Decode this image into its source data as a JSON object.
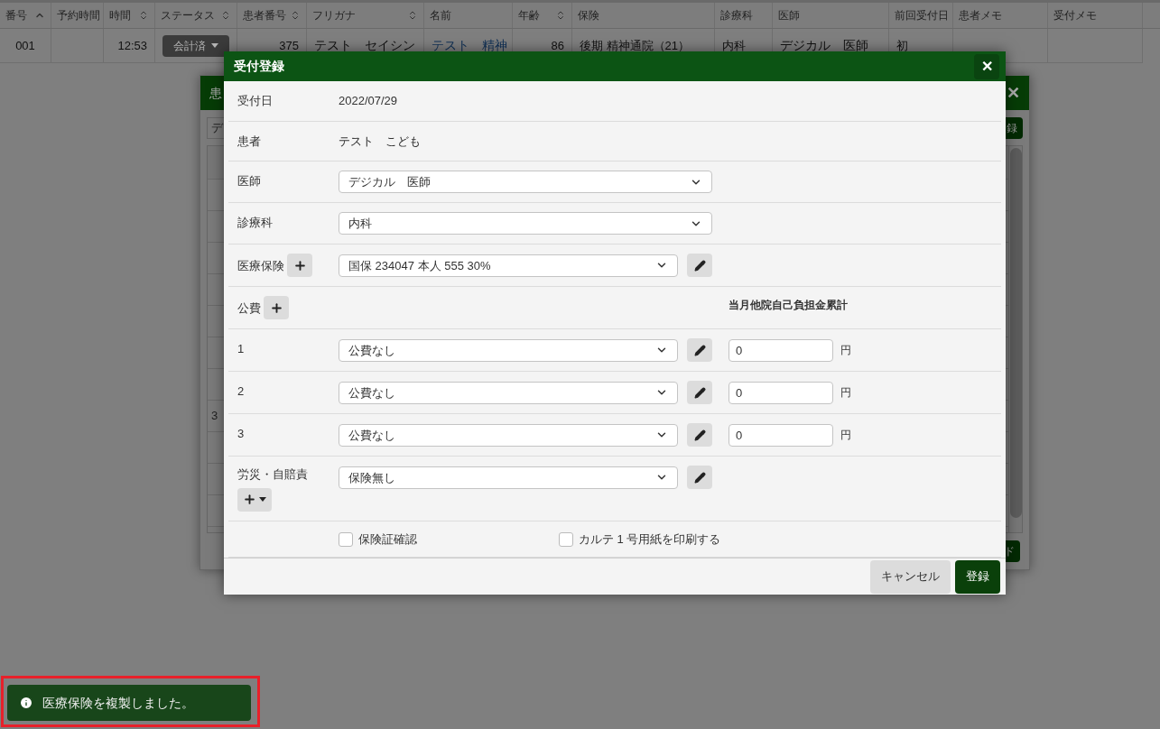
{
  "table": {
    "columns": [
      {
        "label": "番号",
        "sortable": true,
        "sorted": true
      },
      {
        "label": "予約時間",
        "sortable": false,
        "sorted": false
      },
      {
        "label": "時間",
        "sortable": true,
        "sorted": false
      },
      {
        "label": "ステータス",
        "sortable": true,
        "sorted": false
      },
      {
        "label": "患者番号",
        "sortable": true,
        "sorted": false
      },
      {
        "label": "フリガナ",
        "sortable": true,
        "sorted": false
      },
      {
        "label": "名前",
        "sortable": false,
        "sorted": false
      },
      {
        "label": "年齢",
        "sortable": true,
        "sorted": false
      },
      {
        "label": "保険",
        "sortable": false,
        "sorted": false
      },
      {
        "label": "診療科",
        "sortable": false,
        "sorted": false
      },
      {
        "label": "医師",
        "sortable": false,
        "sorted": false
      },
      {
        "label": "前回受付日",
        "sortable": false,
        "sorted": false
      },
      {
        "label": "患者メモ",
        "sortable": false,
        "sorted": false
      },
      {
        "label": "受付メモ",
        "sortable": false,
        "sorted": false
      }
    ],
    "rows": [
      {
        "cells": [
          {
            "kind": "center",
            "text": "001"
          },
          {
            "kind": "blank"
          },
          {
            "kind": "right",
            "text": "12:53"
          },
          {
            "kind": "status",
            "text": "会計済"
          },
          {
            "kind": "right",
            "text": "375"
          },
          {
            "kind": "large",
            "text": "テスト　セイシン"
          },
          {
            "kind": "link",
            "text": "テスト　精神"
          },
          {
            "kind": "right",
            "text": "86"
          },
          {
            "kind": "text",
            "text": "後期 精神通院（21）"
          },
          {
            "kind": "text",
            "text": "内科"
          },
          {
            "kind": "large",
            "text": "デジカル　医師"
          },
          {
            "kind": "text",
            "text": "初"
          },
          {
            "kind": "blank"
          },
          {
            "kind": "blank"
          }
        ]
      }
    ]
  },
  "background_dialog": {
    "title": "患",
    "close": "✕",
    "search_value": "デ",
    "button": "録",
    "footer_button": "ド",
    "rows": [
      {
        "kind": "header"
      },
      {
        "kind": "blank"
      },
      {
        "kind": "blank"
      },
      {
        "kind": "blank"
      },
      {
        "kind": "blank"
      },
      {
        "kind": "blank"
      },
      {
        "kind": "blank"
      },
      {
        "kind": "blank"
      },
      {
        "kind": "text",
        "text": "3"
      },
      {
        "kind": "blank"
      },
      {
        "kind": "blank"
      },
      {
        "kind": "blank"
      }
    ]
  },
  "dialog": {
    "title": "受付登録",
    "close": "✕",
    "rows": [
      {
        "kind": "text",
        "label": "受付日",
        "value": "2022/07/29"
      },
      {
        "kind": "text",
        "label": "患者",
        "value": "テスト　こども"
      },
      {
        "kind": "select",
        "label": "医師",
        "value": "デジカル　医師",
        "edit": false
      },
      {
        "kind": "select",
        "label": "診療科",
        "value": "内科",
        "edit": false
      },
      {
        "kind": "select",
        "label": "医療保険",
        "add": true,
        "add_menu": false,
        "value": "国保 234047 本人 555 30%",
        "edit": true
      },
      {
        "kind": "heading",
        "label": "公費",
        "add": true,
        "add_menu": false,
        "note": "当月他院自己負担金累計"
      },
      {
        "kind": "select",
        "label": "1",
        "value": "公費なし",
        "edit": true,
        "amount": "0",
        "unit": "円"
      },
      {
        "kind": "select",
        "label": "2",
        "value": "公費なし",
        "edit": true,
        "amount": "0",
        "unit": "円"
      },
      {
        "kind": "select",
        "label": "3",
        "value": "公費なし",
        "edit": true,
        "amount": "0",
        "unit": "円"
      },
      {
        "kind": "select",
        "label": "労災・自賠責",
        "add": true,
        "add_menu": true,
        "value": "保険無し",
        "edit": true
      },
      {
        "kind": "checks",
        "checks": [
          {
            "label": "保険証確認",
            "checked": false
          },
          {
            "label": "カルテ 1 号用紙を印刷する",
            "checked": false
          }
        ]
      }
    ],
    "buttons": [
      {
        "kind": "secondary",
        "label": "キャンセル"
      },
      {
        "kind": "primary",
        "label": "登録"
      }
    ]
  },
  "toast": {
    "message": "医療保険を複製しました。",
    "highlighted": true
  }
}
